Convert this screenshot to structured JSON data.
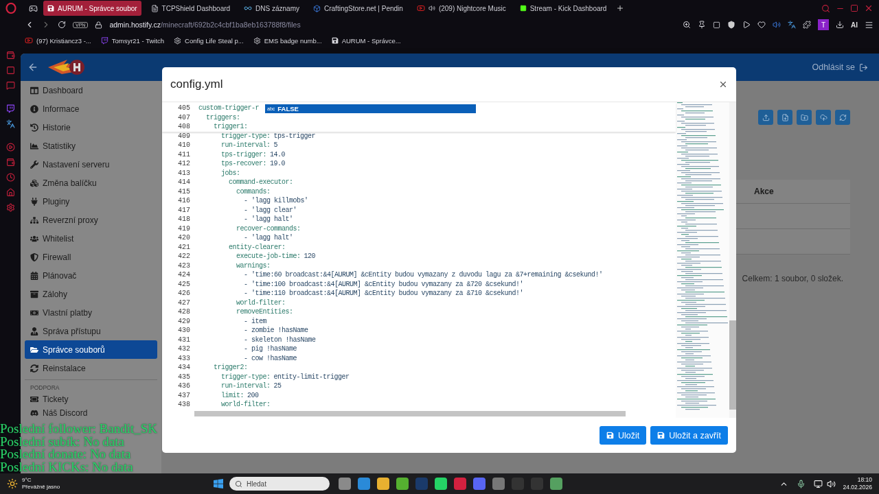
{
  "browser": {
    "tabs": [
      {
        "title": "AURUM - Správce soubor",
        "kind": "file",
        "selected": true
      },
      {
        "title": "TCPShield Dashboard",
        "kind": "page",
        "selected": false
      },
      {
        "title": "DNS záznamy",
        "kind": "infinity",
        "selected": false
      },
      {
        "title": "CraftingStore.net | Pendin",
        "kind": "cube",
        "selected": false
      },
      {
        "title": "(209) Nightcore Music",
        "kind": "video",
        "selected": false
      },
      {
        "title": "Stream - Kick Dashboard",
        "kind": "kick",
        "selected": false
      }
    ],
    "vpn": "VPN",
    "address": {
      "host": "admin.hostify.cz",
      "path": "/minecraft/692b2c4cbf1ba8eb163788f8/files"
    },
    "profile": "T",
    "ai": "AI",
    "bookmarks": [
      {
        "label": "(97) Kristiancz3 -...",
        "kind": "video"
      },
      {
        "label": "Tomsyr21 - Twitch",
        "kind": "twitch"
      },
      {
        "label": "Config Life Steal p...",
        "kind": "gear"
      },
      {
        "label": "EMS badge numb...",
        "kind": "gear"
      },
      {
        "label": "AURUM - Správce...",
        "kind": "file"
      }
    ]
  },
  "header": {
    "logout": "Odhlásit se"
  },
  "sidebar": {
    "items": [
      {
        "label": "Dashboard",
        "selected": false
      },
      {
        "label": "Informace",
        "selected": false
      },
      {
        "label": "Historie",
        "selected": false
      },
      {
        "label": "Statistiky",
        "selected": false
      },
      {
        "label": "Nastavení serveru",
        "selected": false
      },
      {
        "label": "Změna balíčku",
        "selected": false
      },
      {
        "label": "Pluginy",
        "selected": false
      },
      {
        "label": "Reverzní proxy",
        "selected": false
      },
      {
        "label": "Whitelist",
        "selected": false
      },
      {
        "label": "Firewall",
        "selected": false
      },
      {
        "label": "Plánovač",
        "selected": false
      },
      {
        "label": "Zálohy",
        "selected": false
      },
      {
        "label": "Vlastní platby",
        "selected": false
      },
      {
        "label": "Správa přístupu",
        "selected": false
      },
      {
        "label": "Správce souborů",
        "selected": true
      },
      {
        "label": "Reinstalace",
        "selected": false
      }
    ],
    "section": "PODPORA",
    "support": [
      {
        "label": "Tickety"
      },
      {
        "label": "Náš Discord"
      }
    ]
  },
  "content": {
    "column": "Akce",
    "summary": "Celkem: 1 soubor, 0 složek."
  },
  "modal": {
    "title": "config.yml",
    "sticky_lines": [
      {
        "n": "405",
        "key": "custom-trigger-r"
      },
      {
        "n": "407",
        "key": "  triggers:"
      },
      {
        "n": "408",
        "key": "    trigger1:"
      }
    ],
    "suggestion": {
      "tag": "abc",
      "label": "FALSE"
    },
    "lines": [
      {
        "n": "409",
        "key": "      trigger-type:",
        "value": "tps-trigger"
      },
      {
        "n": "410",
        "key": "      run-interval:",
        "value": "5"
      },
      {
        "n": "411",
        "key": "      tps-trigger:",
        "value": "14.0"
      },
      {
        "n": "412",
        "key": "      tps-recover:",
        "value": "19.0"
      },
      {
        "n": "413",
        "key": "      jobs:"
      },
      {
        "n": "414",
        "key": "        command-executor:"
      },
      {
        "n": "415",
        "key": "          commands:"
      },
      {
        "n": "416",
        "value": "            - 'lagg killmobs'"
      },
      {
        "n": "417",
        "value": "            - 'lagg clear'"
      },
      {
        "n": "418",
        "value": "            - 'lagg halt'"
      },
      {
        "n": "419",
        "key": "          recover-commands:"
      },
      {
        "n": "420",
        "value": "            - 'lagg halt'"
      },
      {
        "n": "421",
        "key": "        entity-clearer:"
      },
      {
        "n": "422",
        "key": "          execute-job-time:",
        "value": "120"
      },
      {
        "n": "423",
        "key": "          warnings:"
      },
      {
        "n": "424",
        "value": "            - 'time:60 broadcast:&4[AURUM] &cEntity budou vymazany z duvodu lagu za &7+remaining &csekund!'"
      },
      {
        "n": "425",
        "value": "            - 'time:100 broadcast:&4[AURUM] &cEntity budou vymazany za &720 &csekund!'"
      },
      {
        "n": "426",
        "value": "            - 'time:110 broadcast:&4[AURUM] &cEntity budou vymazany za &710 &csekund!'"
      },
      {
        "n": "427",
        "key": "          world-filter:"
      },
      {
        "n": "428",
        "key": "          removeEntities:"
      },
      {
        "n": "429",
        "value": "            - item"
      },
      {
        "n": "430",
        "value": "            - zombie !hasName"
      },
      {
        "n": "431",
        "value": "            - skeleton !hasName"
      },
      {
        "n": "432",
        "value": "            - pig !hasName"
      },
      {
        "n": "433",
        "value": "            - cow !hasName"
      },
      {
        "n": "434",
        "key": "    trigger2:"
      },
      {
        "n": "435",
        "key": "      trigger-type:",
        "value": "entity-limit-trigger"
      },
      {
        "n": "436",
        "key": "      run-interval:",
        "value": "25"
      },
      {
        "n": "437",
        "key": "      limit:",
        "value": "200"
      },
      {
        "n": "438",
        "key": "      world-filter:"
      }
    ],
    "buttons": [
      {
        "label": "Uložit"
      },
      {
        "label": "Uložit a zavřít"
      }
    ]
  },
  "overlay": [
    "Poslední follower: Bandit_SK",
    "Poslední subík: No data",
    "Poslední donate: No data",
    "Poslední KICKs: No data"
  ],
  "taskbar": {
    "weather": {
      "temp": "9°C",
      "text": "Převážně jasno"
    },
    "search": {
      "placeholder": "Hledat"
    },
    "time": "18:10",
    "date": "24.02.2026"
  }
}
